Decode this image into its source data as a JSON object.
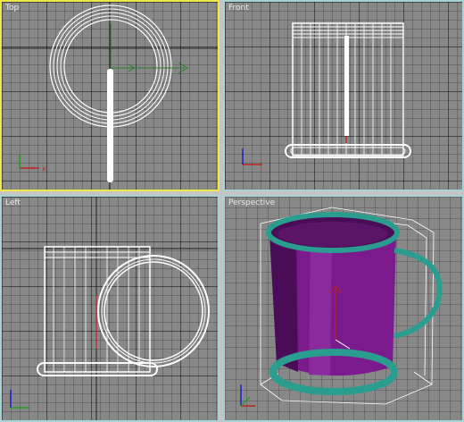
{
  "viewports": {
    "top": {
      "label": "Top",
      "active": true
    },
    "front": {
      "label": "Front",
      "active": false
    },
    "left": {
      "label": "Left",
      "active": false
    },
    "perspective": {
      "label": "Perspective",
      "active": false
    }
  },
  "colors": {
    "active_border": "#f0e84a",
    "inactive_border": "#a8d2d6",
    "viewport_bg": "#888888",
    "wireframe": "#ffffff",
    "mug_body": "#7a1a8c",
    "mug_handle": "#2a9d8f"
  },
  "icons": [
    "axis-tripod-icon",
    "transform-gizmo-icon"
  ]
}
